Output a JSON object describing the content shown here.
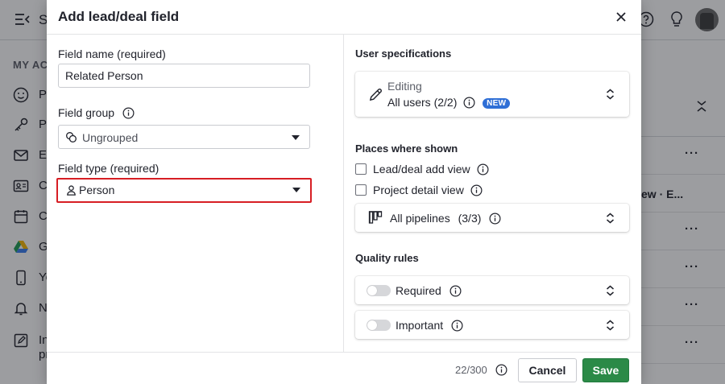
{
  "background": {
    "app_title": "S",
    "sidebar_section": "MY ACC",
    "sidebar_items": [
      {
        "label": "Pe",
        "icon": "smiley-icon"
      },
      {
        "label": "Pa",
        "icon": "key-icon"
      },
      {
        "label": "Em",
        "icon": "envelope-icon"
      },
      {
        "label": "Co",
        "icon": "contact-card-icon"
      },
      {
        "label": "Ca",
        "icon": "calendar-icon"
      },
      {
        "label": "Go",
        "icon": "google-drive-icon"
      },
      {
        "label": "Yo",
        "icon": "phone-icon"
      },
      {
        "label": "No",
        "icon": "bell-icon"
      },
      {
        "label": "In",
        "icon": "edit-doc-icon"
      }
    ],
    "sidebar_extra": "pr",
    "list_text": "ew · E...",
    "row_menu": "···"
  },
  "modal": {
    "title": "Add lead/deal field",
    "field_name_label": "Field name (required)",
    "field_name_value": "Related Person",
    "field_group_label": "Field group",
    "field_group_value": "Ungrouped",
    "field_type_label": "Field type (required)",
    "field_type_value": "Person",
    "user_specs_title": "User specifications",
    "editing_label": "Editing",
    "editing_value": "All users (2/2)",
    "new_badge": "NEW",
    "places_title": "Places where shown",
    "places": [
      "Lead/deal add view",
      "Project detail view"
    ],
    "pipelines": "All pipelines",
    "pipelines_count": "(3/3)",
    "quality_title": "Quality rules",
    "quality": [
      "Required",
      "Important"
    ],
    "counter": "22/300",
    "cancel": "Cancel",
    "save": "Save"
  }
}
